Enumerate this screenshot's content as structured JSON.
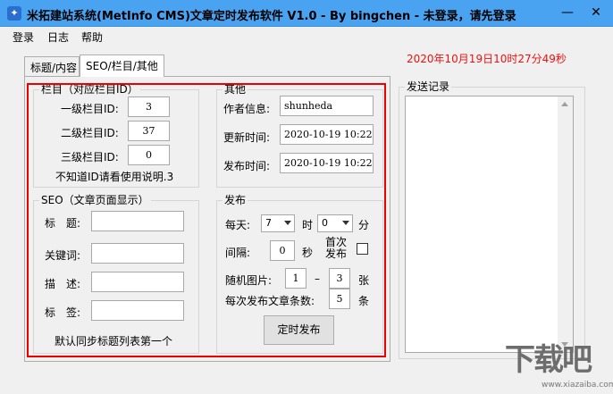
{
  "window": {
    "title": "米拓建站系统(MetInfo CMS)文章定时发布软件 V1.0 - By bingchen - 未登录，请先登录",
    "minimize_glyph": "—",
    "close_glyph": "✕",
    "app_icon_glyph": "✦"
  },
  "menu": {
    "items": [
      "登录",
      "日志",
      "帮助"
    ]
  },
  "timestamp": "2020年10月19日10时27分49秒",
  "tabs": [
    {
      "label": "标题/内容"
    },
    {
      "label": "SEO/栏目/其他"
    }
  ],
  "column": {
    "legend": "栏目（对应栏目ID）",
    "level1_label": "一级栏目ID:",
    "level1_value": "3",
    "level2_label": "二级栏目ID:",
    "level2_value": "37",
    "level3_label": "三级栏目ID:",
    "level3_value": "0",
    "hint": "不知道ID请看使用说明.3"
  },
  "other": {
    "legend": "其他",
    "author_label": "作者信息:",
    "author_value": "shunheda",
    "update_label": "更新时间:",
    "update_value": "2020-10-19 10:22:",
    "publish_label": "发布时间:",
    "publish_value": "2020-10-19 10:22:"
  },
  "seo": {
    "legend": "SEO（文章页面显示）",
    "title_label": "标　题:",
    "title_value": "",
    "keywords_label": "关键词:",
    "keywords_value": "",
    "desc_label": "描　述:",
    "desc_value": "",
    "tags_label": "标　签:",
    "tags_value": "",
    "note": "默认同步标题列表第一个"
  },
  "publish": {
    "legend": "发布",
    "daily_label": "每天:",
    "hour_value": "7",
    "hour_unit": "时",
    "minute_value": "0",
    "minute_unit": "分",
    "interval_label": "间隔:",
    "interval_value": "0",
    "interval_unit": "秒",
    "first_publish_label": "首次发布",
    "first_publish_checked": false,
    "random_img_label": "随机图片:",
    "random_min": "1",
    "random_sep": "–",
    "random_max": "3",
    "random_unit": "张",
    "per_count_label": "每次发布文章条数:",
    "per_count_value": "5",
    "per_count_unit": "条",
    "button_label": "定时发布"
  },
  "sendlog": {
    "legend": "发送记录"
  },
  "watermark": {
    "text": "下载吧",
    "url": "www.xiazaiba.com"
  },
  "colors": {
    "titlebar": "#4aa3f0",
    "highlight_box": "#e00000",
    "timestamp": "#e01111"
  }
}
